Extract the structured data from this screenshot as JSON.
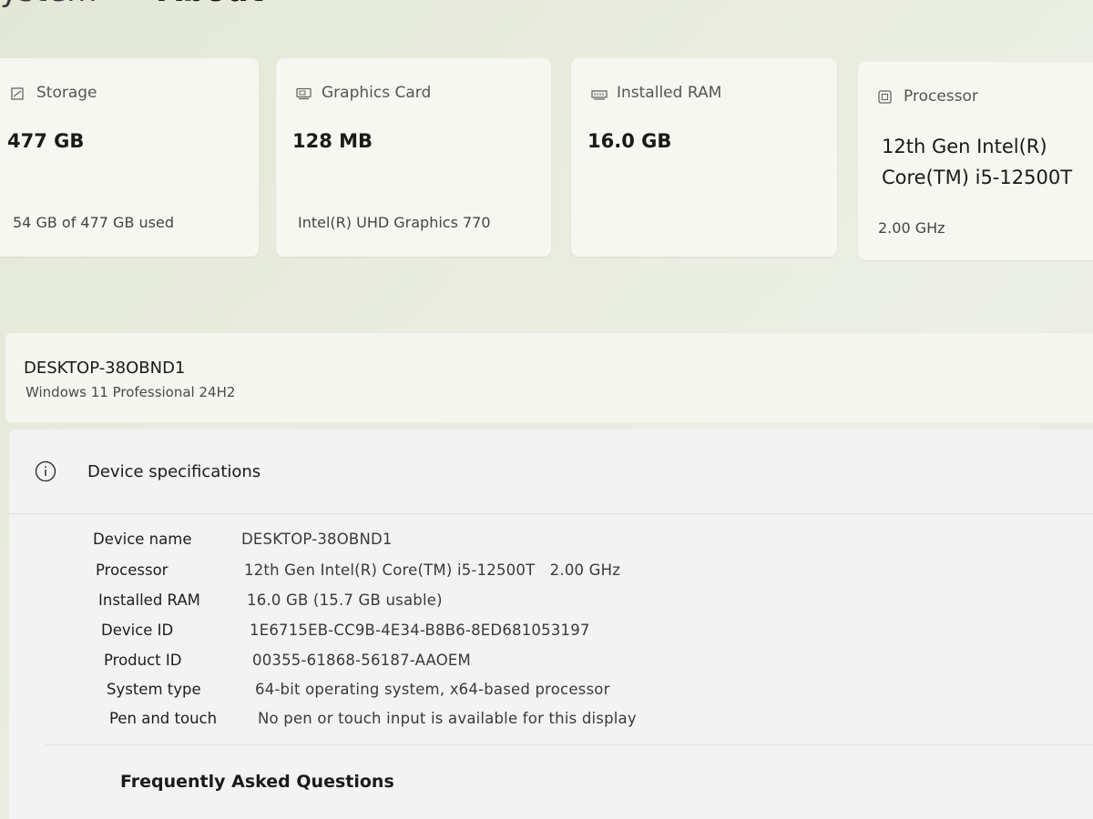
{
  "breadcrumb": {
    "parent": "ystem",
    "separator": "›",
    "current": "About"
  },
  "cards": [
    {
      "icon": "storage-icon",
      "label": "Storage",
      "value": "477 GB",
      "sub": "54 GB of 477 GB used"
    },
    {
      "icon": "graphics-card-icon",
      "label": "Graphics Card",
      "value": "128 MB",
      "sub": "Intel(R) UHD Graphics 770"
    },
    {
      "icon": "ram-icon",
      "label": "Installed RAM",
      "value": "16.0 GB",
      "sub": ""
    },
    {
      "icon": "processor-icon",
      "label": "Processor",
      "value_line1": "12th Gen Intel(R)",
      "value_line2": "Core(TM) i5-12500T",
      "sub": "2.00 GHz"
    }
  ],
  "device": {
    "name": "DESKTOP-38OBND1",
    "os": "Windows 11 Professional 24H2"
  },
  "specs": {
    "title": "Device specifications",
    "icon": "info-icon",
    "rows": [
      {
        "label": "Device name",
        "value": "DESKTOP-38OBND1"
      },
      {
        "label": "Processor",
        "value": "12th Gen Intel(R) Core(TM) i5-12500T   2.00 GHz"
      },
      {
        "label": "Installed RAM",
        "value": "16.0 GB (15.7 GB usable)"
      },
      {
        "label": "Device ID",
        "value": "1E6715EB-CC9B-4E34-B8B6-8ED681053197"
      },
      {
        "label": "Product ID",
        "value": "00355-61868-56187-AAOEM"
      },
      {
        "label": "System type",
        "value": "64-bit operating system, x64-based processor"
      },
      {
        "label": "Pen and touch",
        "value": "No pen or touch input is available for this display"
      }
    ]
  },
  "faq": {
    "title": "Frequently Asked Questions"
  }
}
